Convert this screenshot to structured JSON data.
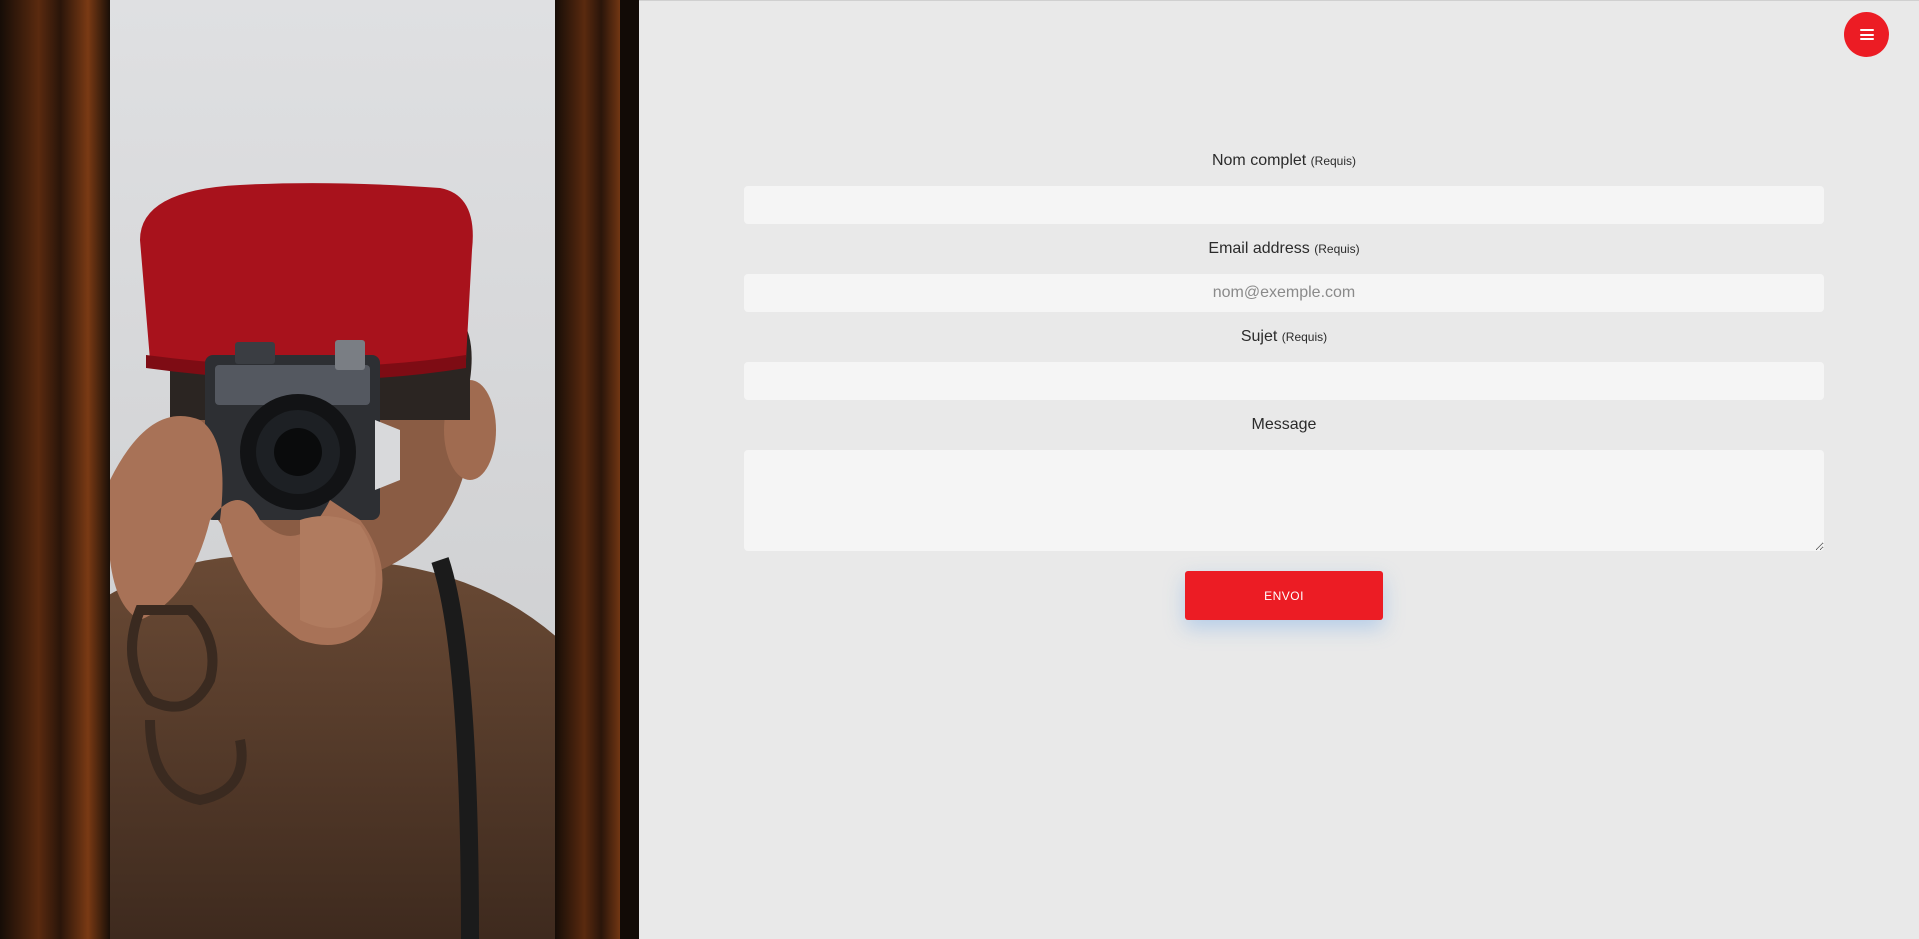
{
  "theme": {
    "accent": "#ec1c24",
    "page_background": "#e9e9e9",
    "input_background": "#f5f5f5"
  },
  "header": {
    "menu_icon": "hamburger-menu-icon"
  },
  "hero_image": {
    "subject": "photographer-with-camera-in-mirror"
  },
  "form": {
    "full_name": {
      "label": "Nom complet",
      "required_note": "(Requis)",
      "value": ""
    },
    "email": {
      "label": "Email address",
      "required_note": "(Requis)",
      "placeholder": "nom@exemple.com",
      "value": ""
    },
    "subject": {
      "label": "Sujet",
      "required_note": "(Requis)",
      "value": ""
    },
    "message": {
      "label": "Message",
      "value": ""
    },
    "submit_label": "ENVOI"
  }
}
